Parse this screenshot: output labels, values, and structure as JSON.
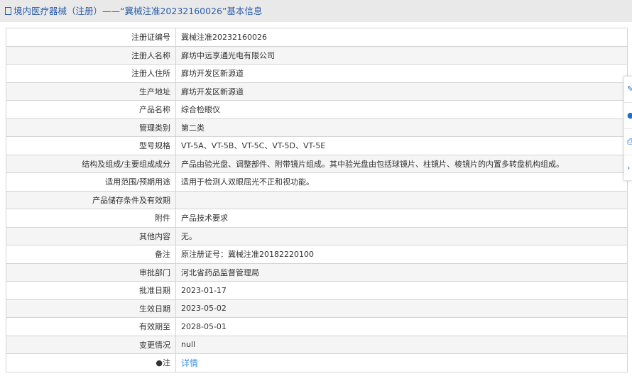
{
  "header": {
    "title": "境内医疗器械（注册）——“冀械注准20232160026”基本信息"
  },
  "rows": [
    {
      "label": "注册证编号",
      "value": "冀械注准20232160026"
    },
    {
      "label": "注册人名称",
      "value": "廊坊中远享通光电有限公司"
    },
    {
      "label": "注册人住所",
      "value": "廊坊开发区新源道"
    },
    {
      "label": "生产地址",
      "value": "廊坊开发区新源道"
    },
    {
      "label": "产品名称",
      "value": "综合检眼仪"
    },
    {
      "label": "管理类别",
      "value": "第二类"
    },
    {
      "label": "型号规格",
      "value": "VT-5A、VT-5B、VT-5C、VT-5D、VT-5E"
    },
    {
      "label": "结构及组成/主要组成成分",
      "value": "产品由验光盘、调整部件、附带镜片组成。其中验光盘由包括球镜片、柱镜片、棱镜片的内置多转盘机构组成。"
    },
    {
      "label": "适用范围/预期用途",
      "value": "适用于检测人双眼屈光不正和视功能。"
    },
    {
      "label": "产品储存条件及有效期",
      "value": ""
    },
    {
      "label": "附件",
      "value": "产品技术要求"
    },
    {
      "label": "其他内容",
      "value": "无。"
    },
    {
      "label": "备注",
      "value": "原注册证号：冀械注准20182220100"
    },
    {
      "label": "审批部门",
      "value": "河北省药品监督管理局"
    },
    {
      "label": "批准日期",
      "value": "2023-01-17"
    },
    {
      "label": "生效日期",
      "value": "2023-05-02"
    },
    {
      "label": "有效期至",
      "value": "2028-05-01"
    },
    {
      "label": "变更情况",
      "value": "null"
    }
  ],
  "note": {
    "label": "注",
    "link": "详情"
  }
}
